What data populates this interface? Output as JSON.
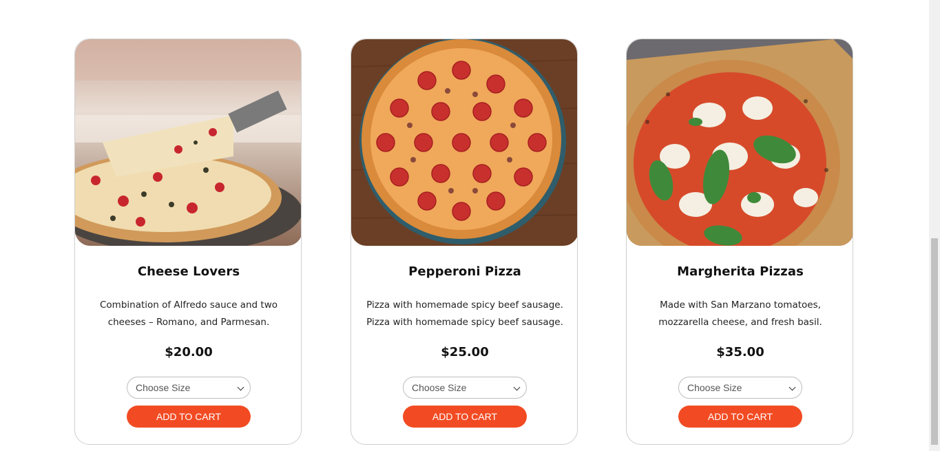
{
  "products": [
    {
      "name": "Cheese Lovers",
      "description": "Combination of Alfredo sauce and two cheeses – Romano, and Parmesan.",
      "price": "$20.00",
      "size_placeholder": "Choose Size",
      "cart_label": "ADD TO CART",
      "image": "cheese-pizza-photo"
    },
    {
      "name": "Pepperoni Pizza",
      "description": "Pizza with homemade spicy beef sausage. Pizza with homemade spicy beef sausage.",
      "price": "$25.00",
      "size_placeholder": "Choose Size",
      "cart_label": "ADD TO CART",
      "image": "pepperoni-pizza-photo"
    },
    {
      "name": "Margherita Pizzas",
      "description": "Made with San Marzano tomatoes, mozzarella cheese, and fresh basil.",
      "price": "$35.00",
      "size_placeholder": "Choose Size",
      "cart_label": "ADD TO CART",
      "image": "margherita-pizza-photo"
    }
  ],
  "colors": {
    "accent": "#f24b23",
    "card_border": "#cfcfcf",
    "text": "#111111"
  }
}
